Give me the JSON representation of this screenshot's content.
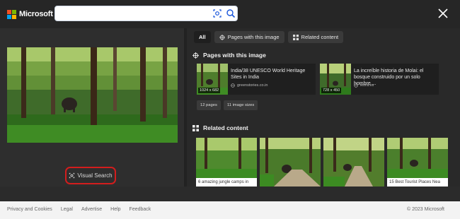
{
  "brand": {
    "name": "Microsoft Bing",
    "colors": [
      "#f25022",
      "#7fba00",
      "#00a4ef",
      "#ffb900"
    ]
  },
  "search": {
    "value": "",
    "placeholder": ""
  },
  "left": {
    "visual_search_label": "Visual Search"
  },
  "tabs": [
    {
      "label": "All",
      "active": true
    },
    {
      "label": "Pages with this image",
      "icon": "pages-icon"
    },
    {
      "label": "Related content",
      "icon": "grid-icon"
    }
  ],
  "pages_section": {
    "title": "Pages with this image",
    "cards": [
      {
        "title": "India/38 UNESCO World Heritage Sites in India",
        "domain": "greenstories.co.in",
        "dims": "1024 x 682"
      },
      {
        "title": "La increíble historia de Molai: el bosque construido por un solo hombre ...",
        "domain": "ikora.es",
        "dims": "728 x 450"
      }
    ],
    "chips": [
      "12 pages",
      "11 image sizes"
    ]
  },
  "related_section": {
    "title": "Related content",
    "items": [
      {
        "caption": "6 amazing jungle camps in"
      },
      {
        "caption": ""
      },
      {
        "caption": ""
      },
      {
        "caption": "15 Best Tourist Places Nea"
      }
    ]
  },
  "footer": {
    "links": [
      "Privacy and Cookies",
      "Legal",
      "Advertise",
      "Help",
      "Feedback"
    ],
    "copyright": "© 2023 Microsoft"
  },
  "theme": {
    "accent_red": "#d31d1d",
    "search_icon_blue": "#1a56db"
  }
}
